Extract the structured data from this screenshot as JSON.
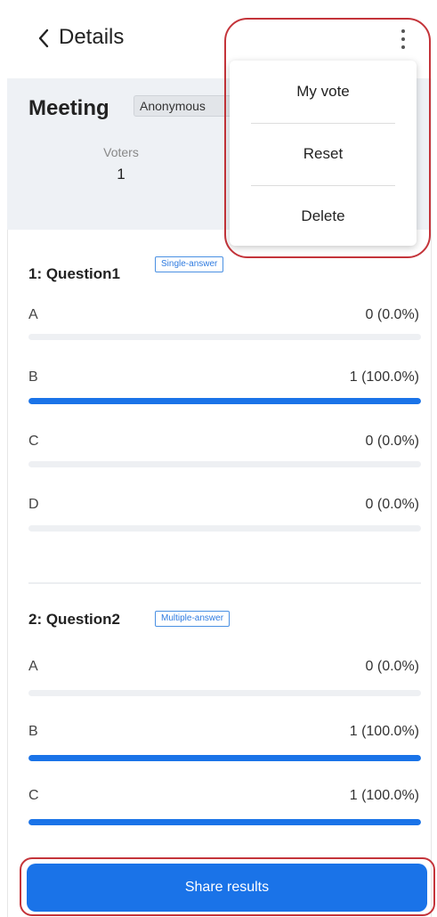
{
  "header": {
    "title": "Details"
  },
  "summary": {
    "title": "Meeting",
    "badge": "Anonymous",
    "voters_label": "Voters",
    "voters_count": "1"
  },
  "questions": [
    {
      "title": "1: Question1",
      "badge": "Single-answer",
      "options": [
        {
          "label": "A",
          "value": "0 (0.0%)",
          "fraction": 0.0
        },
        {
          "label": "B",
          "value": "1 (100.0%)",
          "fraction": 1.0
        },
        {
          "label": "C",
          "value": "0 (0.0%)",
          "fraction": 0.0
        },
        {
          "label": "D",
          "value": "0 (0.0%)",
          "fraction": 0.0
        }
      ]
    },
    {
      "title": "2: Question2",
      "badge": "Multiple-answer",
      "options": [
        {
          "label": "A",
          "value": "0 (0.0%)",
          "fraction": 0.0
        },
        {
          "label": "B",
          "value": "1 (100.0%)",
          "fraction": 1.0
        },
        {
          "label": "C",
          "value": "1 (100.0%)",
          "fraction": 1.0
        }
      ]
    }
  ],
  "menu": {
    "items": [
      "My vote",
      "Reset",
      "Delete"
    ]
  },
  "footer": {
    "share_label": "Share results"
  },
  "colors": {
    "accent": "#1a73e8",
    "highlight": "#c4343a",
    "summary_bg": "#eef1f5"
  }
}
